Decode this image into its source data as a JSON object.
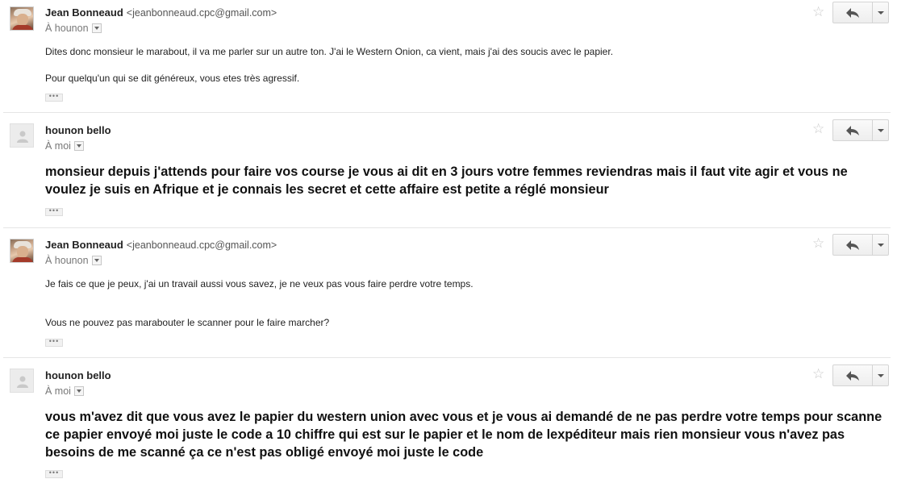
{
  "messages": [
    {
      "sender_name": "Jean Bonneaud",
      "sender_email": "<jeanbonneaud.cpc@gmail.com>",
      "recipient": "À hounon",
      "paragraphs": [
        "Dites donc monsieur le marabout, il va me parler sur un autre ton. J'ai le Western Onion, ca vient, mais j'ai des soucis avec le papier.",
        "Pour quelqu'un qui se dit généreux, vous etes très agressif."
      ]
    },
    {
      "sender_name": "hounon bello",
      "recipient": "À moi",
      "body": "monsieur depuis j'attends pour faire vos course je vous ai dit en 3 jours votre femmes reviendras mais il faut vite agir et vous ne voulez je suis en Afrique et je connais les secret et cette affaire est petite a réglé monsieur"
    },
    {
      "sender_name": "Jean Bonneaud",
      "sender_email": "<jeanbonneaud.cpc@gmail.com>",
      "recipient": "À hounon",
      "paragraphs": [
        "Je fais ce que je peux, j'ai un travail aussi vous savez, je ne veux pas vous faire perdre votre temps.",
        "Vous ne pouvez pas marabouter le scanner pour le faire marcher?"
      ]
    },
    {
      "sender_name": "hounon bello",
      "recipient": "À moi",
      "body": "vous m'avez dit que vous avez le papier du western union avec vous et je vous ai demandé de ne pas perdre votre temps pour scanne ce papier envoyé moi juste le code a 10 chiffre qui est sur le papier et le nom de lexpéditeur mais rien monsieur vous n'avez pas besoins de me scanné ça ce n'est pas obligé envoyé moi juste le code"
    }
  ],
  "ui": {
    "star_glyph": "☆",
    "dots_glyph": "•••"
  },
  "colors": {
    "separator": "#e5e5e5",
    "button_border": "#d4d4d4",
    "meta_text": "#777777"
  }
}
